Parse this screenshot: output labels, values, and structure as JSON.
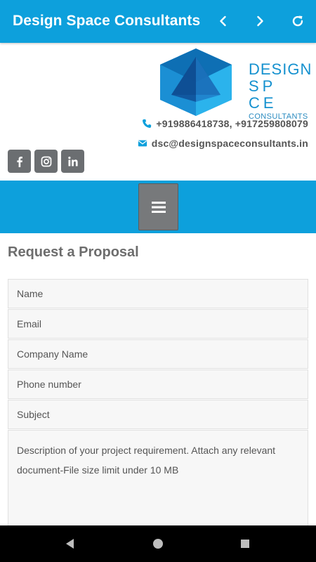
{
  "appbar": {
    "title": "Design Space Consultants",
    "back_icon": "chevron-left-icon",
    "forward_icon": "chevron-right-icon",
    "reload_icon": "refresh-icon",
    "color": "#0da0dc"
  },
  "logo": {
    "line1": "DESIGN",
    "line2": "SP CE",
    "line3": "CONSULTANTS"
  },
  "contact": {
    "phone": "+919886418738, +917259808079",
    "email": "dsc@designspaceconsultants.in"
  },
  "socials": [
    {
      "name": "facebook-icon"
    },
    {
      "name": "instagram-icon"
    },
    {
      "name": "linkedin-icon"
    }
  ],
  "menu": {
    "icon": "hamburger-menu-icon"
  },
  "form": {
    "title": "Request a Proposal",
    "fields": {
      "name": "Name",
      "email": "Email",
      "company": "Company Name",
      "phone": "Phone number",
      "subject": "Subject",
      "description": "Description of your project requirement. Attach any relevant document-File size limit under 10 MB"
    }
  },
  "system_nav": {
    "back": "back-triangle-icon",
    "home": "home-circle-icon",
    "recents": "recents-square-icon"
  }
}
